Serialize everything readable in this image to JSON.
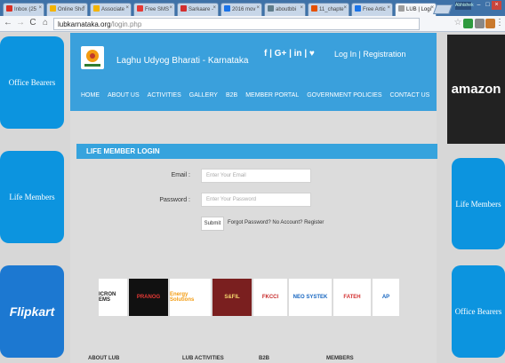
{
  "browser": {
    "tabs": [
      {
        "label": "Inbox (25",
        "color": "#d93025"
      },
      {
        "label": "Online Sho",
        "color": "#f4b400"
      },
      {
        "label": "Associate",
        "color": "#f4b400"
      },
      {
        "label": "Free SMS",
        "color": "#e53935"
      },
      {
        "label": "Sarkaare - ",
        "color": "#d32f2f"
      },
      {
        "label": "2016 mov",
        "color": "#1a73e8"
      },
      {
        "label": "aboutbbi",
        "color": "#607d8b"
      },
      {
        "label": "11_chapte",
        "color": "#e65100"
      },
      {
        "label": "Free Artic",
        "color": "#1a73e8"
      },
      {
        "label": "LUB | Logi",
        "color": "#9e9e9e",
        "active": true
      }
    ],
    "profile_badge": "Abhishek",
    "address": {
      "host": "lubkarnataka.org",
      "path": "/login.php"
    }
  },
  "site": {
    "title": "Laghu Udyog Bharati - Karnataka",
    "social": "f | G+ | in | ♥",
    "login_label": "Log In",
    "separator": "|",
    "registration_label": "Registration",
    "menu": [
      "HOME",
      "ABOUT US",
      "ACTIVITIES",
      "GALLERY",
      "B2B",
      "MEMBER PORTAL",
      "GOVERNMENT POLICIES",
      "CONTACT US"
    ]
  },
  "sidebar_left": [
    {
      "label": "Office Bearers"
    },
    {
      "label": "Life Members"
    },
    {
      "label": "Flipkart"
    }
  ],
  "sidebar_right": [
    {
      "label": "amazon"
    },
    {
      "label": "Life Members"
    },
    {
      "label": "Office Bearers"
    }
  ],
  "login": {
    "heading": "LIFE MEMBER LOGIN",
    "email_label": "Email :",
    "email_placeholder": "Enter Your Email",
    "password_label": "Password :",
    "password_placeholder": "Enter Your Password",
    "submit_label": "Submit",
    "forgot_link": "Forgot Password?",
    "register_link": "No Account? Register"
  },
  "sponsors": [
    "ICRON EMS",
    "PRANOG",
    "Energy Solutions",
    "S&FIL",
    "FKCCI",
    "NEO SYSTEK",
    "FATEH",
    "AP"
  ],
  "footer": [
    "ABOUT LUB",
    "LUB ACTIVITIES",
    "B2B",
    "MEMBERS"
  ]
}
